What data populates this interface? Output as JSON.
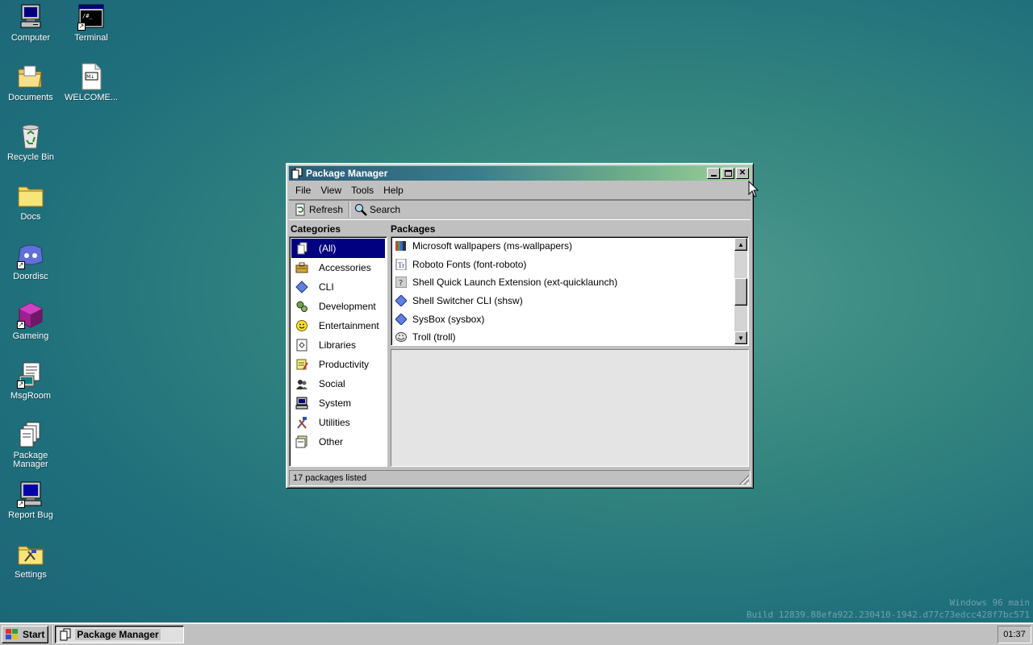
{
  "desktop": {
    "icons": [
      {
        "label": "Computer",
        "icon": "computer-icon"
      },
      {
        "label": "Terminal",
        "icon": "terminal-icon"
      },
      {
        "label": "Documents",
        "icon": "folder-open-icon"
      },
      {
        "label": "WELCOME...",
        "icon": "markdown-file-icon"
      },
      {
        "label": "Recycle Bin",
        "icon": "recycle-bin-icon"
      },
      {
        "label": "Docs",
        "icon": "folder-icon"
      },
      {
        "label": "Doordisc",
        "icon": "doordisc-icon"
      },
      {
        "label": "Gameing",
        "icon": "gameing-icon"
      },
      {
        "label": "MsgRoom",
        "icon": "msgroom-icon"
      },
      {
        "label": "Package Manager",
        "icon": "package-manager-icon"
      },
      {
        "label": "Report Bug",
        "icon": "report-bug-icon"
      },
      {
        "label": "Settings",
        "icon": "settings-icon"
      }
    ]
  },
  "window": {
    "title": "Package Manager",
    "menu": [
      "File",
      "View",
      "Tools",
      "Help"
    ],
    "toolbar": {
      "refresh": "Refresh",
      "search": "Search"
    },
    "categories_header": "Categories",
    "packages_header": "Packages",
    "categories": [
      {
        "label": "(All)",
        "icon": "all-icon",
        "selected": true
      },
      {
        "label": "Accessories",
        "icon": "accessories-icon"
      },
      {
        "label": "CLI",
        "icon": "cli-icon"
      },
      {
        "label": "Development",
        "icon": "development-icon"
      },
      {
        "label": "Entertainment",
        "icon": "entertainment-icon"
      },
      {
        "label": "Libraries",
        "icon": "libraries-icon"
      },
      {
        "label": "Productivity",
        "icon": "productivity-icon"
      },
      {
        "label": "Social",
        "icon": "social-icon"
      },
      {
        "label": "System",
        "icon": "system-icon"
      },
      {
        "label": "Utilities",
        "icon": "utilities-icon"
      },
      {
        "label": "Other",
        "icon": "other-icon"
      }
    ],
    "packages": [
      {
        "label": "Microsoft wallpapers (ms-wallpapers)",
        "icon": "wallpaper-icon"
      },
      {
        "label": "Roboto Fonts (font-roboto)",
        "icon": "font-icon"
      },
      {
        "label": "Shell Quick Launch Extension (ext-quicklaunch)",
        "icon": "extension-icon"
      },
      {
        "label": "Shell Switcher CLI (shsw)",
        "icon": "cli-package-icon"
      },
      {
        "label": "SysBox (sysbox)",
        "icon": "cli-package-icon"
      },
      {
        "label": "Troll (troll)",
        "icon": "troll-icon"
      }
    ],
    "status": "17 packages listed"
  },
  "watermark": {
    "line1": "Windows 96 main",
    "line2": "Build 12839.88efa922.230410-1942.d77c73edcc428f7bc571"
  },
  "taskbar": {
    "start": "Start",
    "task": "Package Manager",
    "clock": "01:37"
  },
  "colors": {
    "selection": "#000080",
    "face": "#c0c0c0",
    "desktop": "#2a7a80"
  }
}
